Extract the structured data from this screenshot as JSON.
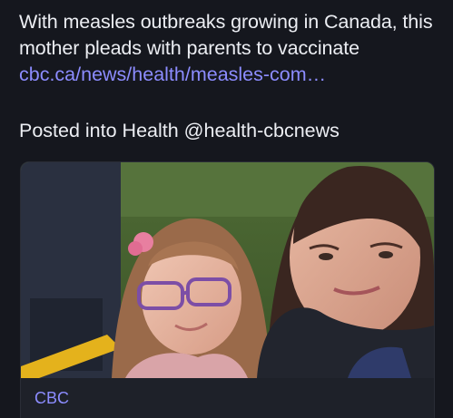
{
  "post": {
    "text": "With measles outbreaks growing in Canada, this mother pleads with parents to vaccinate",
    "link": "cbc.ca/news/health/measles-com…",
    "posted_into": "Posted into Health @health-cbcnews"
  },
  "card": {
    "image_icon": "photo-mother-and-daughter-selfie",
    "source": "CBC"
  },
  "colors": {
    "background": "#15171e",
    "link": "#8c8cff",
    "text": "#eceef3"
  }
}
